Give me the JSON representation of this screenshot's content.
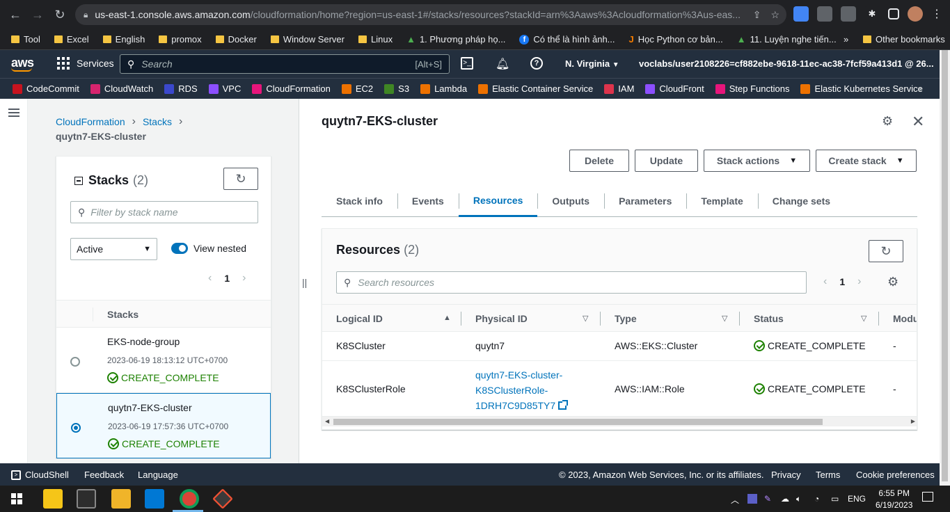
{
  "browser": {
    "url_host": "us-east-1.console.aws.amazon.com",
    "url_rest": "/cloudformation/home?region=us-east-1#/stacks/resources?stackId=arn%3Aaws%3Acloudformation%3Aus-eas...",
    "bookmarks": [
      "Tool",
      "Excel",
      "English",
      "promox",
      "Docker",
      "Window Server",
      "Linux",
      "1. Phương pháp họ...",
      "Có thể là hình ảnh...",
      "Học Python cơ bản...",
      "11. Luyện nghe tiến..."
    ],
    "more": "»",
    "other_bookmarks": "Other bookmarks"
  },
  "aws_header": {
    "logo": "aws",
    "services": "Services",
    "search_placeholder": "Search",
    "search_shortcut": "[Alt+S]",
    "region": "N. Virginia",
    "account": "voclabs/user2108226=cf882ebe-9618-11ec-ac38-7fcf59a413d1 @ 26..."
  },
  "favorites": [
    {
      "label": "CodeCommit",
      "color": "#c7131f"
    },
    {
      "label": "CloudWatch",
      "color": "#d6246e"
    },
    {
      "label": "RDS",
      "color": "#3b48cc"
    },
    {
      "label": "VPC",
      "color": "#8c4fff"
    },
    {
      "label": "CloudFormation",
      "color": "#e7157b"
    },
    {
      "label": "EC2",
      "color": "#ed7100"
    },
    {
      "label": "S3",
      "color": "#3f8624"
    },
    {
      "label": "Lambda",
      "color": "#ed7100"
    },
    {
      "label": "Elastic Container Service",
      "color": "#ed7100"
    },
    {
      "label": "IAM",
      "color": "#dd344c"
    },
    {
      "label": "CloudFront",
      "color": "#8c4fff"
    },
    {
      "label": "Step Functions",
      "color": "#e7157b"
    },
    {
      "label": "Elastic Kubernetes Service",
      "color": "#ed7100"
    }
  ],
  "breadcrumb": {
    "items": [
      "CloudFormation",
      "Stacks"
    ],
    "current": "quytn7-EKS-cluster"
  },
  "stacks_panel": {
    "title": "Stacks",
    "count": "(2)",
    "filter_placeholder": "Filter by stack name",
    "status_filter": "Active",
    "view_nested": "View nested",
    "page": "1",
    "column": "Stacks",
    "rows": [
      {
        "name": "EKS-node-group",
        "date": "2023-06-19 18:13:12 UTC+0700",
        "status": "CREATE_COMPLETE",
        "selected": false
      },
      {
        "name": "quytn7-EKS-cluster",
        "date": "2023-06-19 17:57:36 UTC+0700",
        "status": "CREATE_COMPLETE",
        "selected": true
      }
    ]
  },
  "detail": {
    "title": "quytn7-EKS-cluster",
    "buttons": {
      "delete": "Delete",
      "update": "Update",
      "stack_actions": "Stack actions",
      "create_stack": "Create stack"
    },
    "tabs": [
      "Stack info",
      "Events",
      "Resources",
      "Outputs",
      "Parameters",
      "Template",
      "Change sets"
    ],
    "active_tab": "Resources"
  },
  "resources": {
    "title": "Resources",
    "count": "(2)",
    "search_placeholder": "Search resources",
    "page": "1",
    "columns": [
      "Logical ID",
      "Physical ID",
      "Type",
      "Status",
      "Modu"
    ],
    "rows": [
      {
        "logical_id": "K8SCluster",
        "physical_id": "quytn7",
        "type": "AWS::EKS::Cluster",
        "status": "CREATE_COMPLETE",
        "module": "-"
      },
      {
        "logical_id": "K8SClusterRole",
        "physical_id_lines": [
          "quytn7-EKS-cluster-",
          "K8SClusterRole-",
          "1DRH7C9D85TY7"
        ],
        "type": "AWS::IAM::Role",
        "status": "CREATE_COMPLETE",
        "module": "-"
      }
    ]
  },
  "footer": {
    "cloudshell": "CloudShell",
    "feedback": "Feedback",
    "language": "Language",
    "copyright": "© 2023, Amazon Web Services, Inc. or its affiliates.",
    "privacy": "Privacy",
    "terms": "Terms",
    "cookies": "Cookie preferences"
  },
  "taskbar": {
    "lang": "ENG",
    "time": "6:55 PM",
    "date": "6/19/2023"
  }
}
